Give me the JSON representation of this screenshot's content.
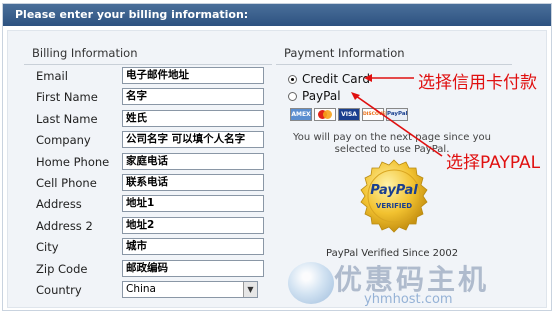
{
  "header": {
    "title": "Please enter your billing information:"
  },
  "billing": {
    "legend": "Billing Information",
    "rows": [
      {
        "label": "Email",
        "value": "电子邮件地址"
      },
      {
        "label": "First Name",
        "value": "名字"
      },
      {
        "label": "Last Name",
        "value": "姓氏"
      },
      {
        "label": "Company",
        "value": "公司名字 可以填个人名字"
      },
      {
        "label": "Home Phone",
        "value": "家庭电话"
      },
      {
        "label": "Cell Phone",
        "value": "联系电话"
      },
      {
        "label": "Address",
        "value": "地址1"
      },
      {
        "label": "Address 2",
        "value": "地址2"
      },
      {
        "label": "City",
        "value": "城市"
      },
      {
        "label": "Zip Code",
        "value": "邮政编码"
      },
      {
        "label": "Country",
        "value": "China"
      }
    ]
  },
  "payment": {
    "legend": "Payment Information",
    "options": [
      {
        "label": "Credit Card",
        "selected": true
      },
      {
        "label": "PayPal",
        "selected": false
      }
    ],
    "card_logos": [
      "AMEX",
      "MC",
      "VISA",
      "DISCOVER",
      "PayPal"
    ],
    "note": "You will pay on the next page since you selected to use PayPal.",
    "seal": {
      "line1": "PayPal",
      "line2": "VERIFIED"
    },
    "since": "PayPal Verified Since 2002"
  },
  "annotations": {
    "credit_card": "选择信用卡付款",
    "paypal": "选择PAYPAL"
  },
  "watermark": {
    "text": "优惠码主机",
    "url": "yhmhost.com"
  },
  "colors": {
    "header_bg": "#2d5280",
    "annotation": "#e01010"
  }
}
